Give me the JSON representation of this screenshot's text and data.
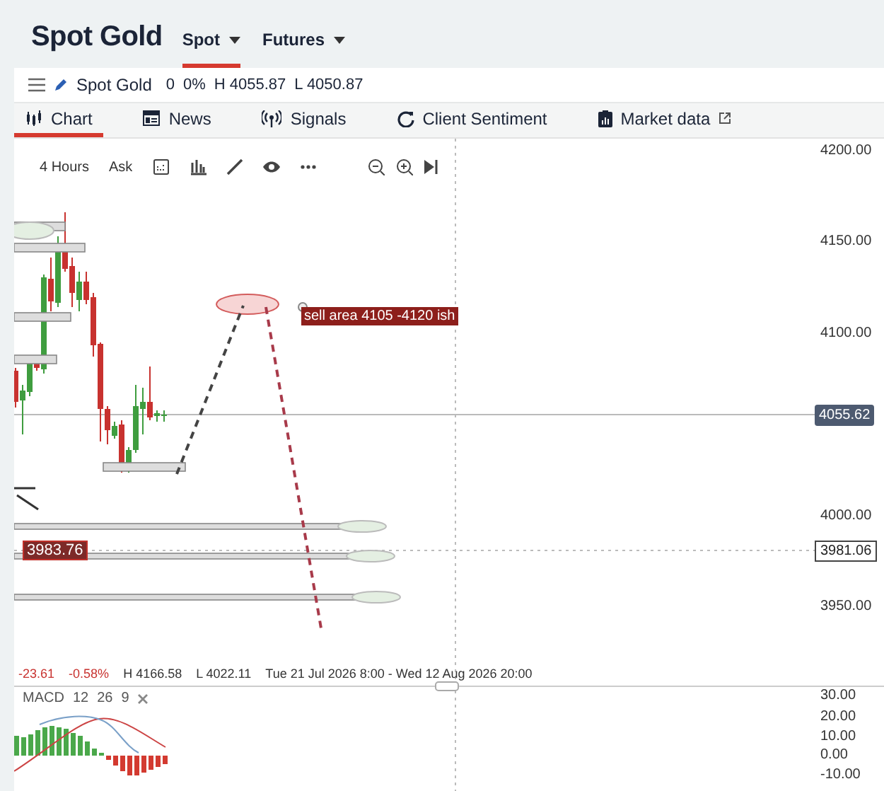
{
  "header": {
    "title": "Spot Gold",
    "tabs": [
      {
        "label": "Spot",
        "selected": true
      },
      {
        "label": "Futures",
        "selected": false
      }
    ]
  },
  "instrument_bar": {
    "name": "Spot Gold",
    "change": "0",
    "change_pct": "0%",
    "high": "H 4055.87",
    "low": "L 4050.87"
  },
  "nav_tabs": [
    {
      "label": "Chart",
      "selected": true,
      "external": false
    },
    {
      "label": "News",
      "selected": false,
      "external": false
    },
    {
      "label": "Signals",
      "selected": false,
      "external": false
    },
    {
      "label": "Client Sentiment",
      "selected": false,
      "external": false
    },
    {
      "label": "Market data",
      "selected": false,
      "external": true
    }
  ],
  "toolbar": {
    "interval": "4 Hours",
    "price_type": "Ask"
  },
  "price_axis": [
    "4200.00",
    "4150.00",
    "4100.00",
    "4000.00",
    "3950.00"
  ],
  "last_price": "4055.62",
  "crosshair_price": "3981.06",
  "annotation": "sell area 4105 -4120 ish",
  "level_label": "3983.76",
  "stats": {
    "change": "-23.61",
    "change_pct": "-0.58%",
    "high": "H 4166.58",
    "low": "L 4022.11",
    "range": "Tue 21 Jul 2026 8:00 - Wed 12 Aug 2026 20:00"
  },
  "macd": {
    "name": "MACD",
    "params": [
      "12",
      "26",
      "9"
    ],
    "axis": [
      "30.00",
      "20.00",
      "10.00",
      "0.00",
      "-10.00"
    ]
  }
}
